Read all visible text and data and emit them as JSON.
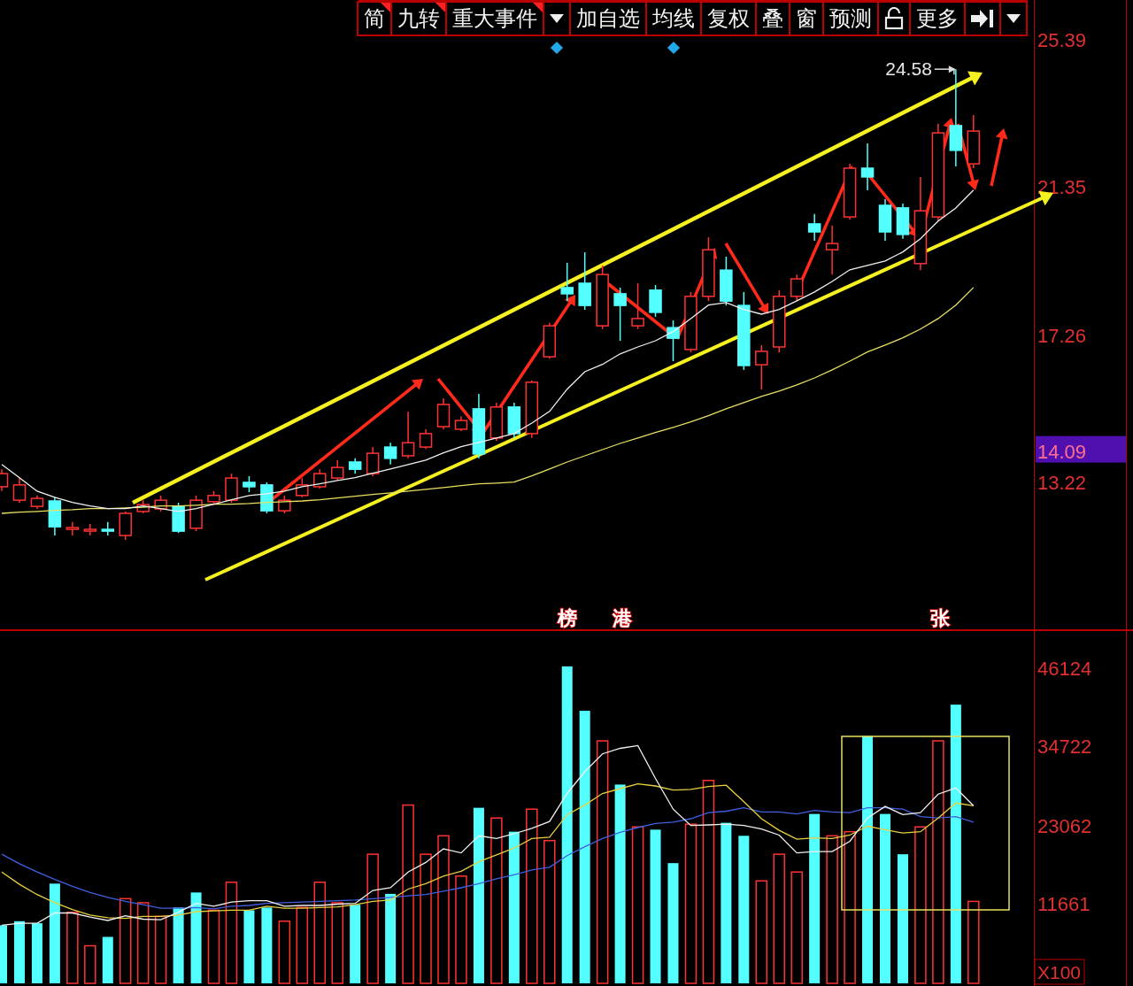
{
  "toolbar": [
    {
      "kind": "text",
      "label": "简",
      "flagged": true,
      "marked": false
    },
    {
      "kind": "text",
      "label": "九转",
      "flagged": true,
      "marked": false
    },
    {
      "kind": "text",
      "label": "重大事件",
      "flagged": true,
      "marked": false
    },
    {
      "kind": "dropdown",
      "flagged": false,
      "marked": true
    },
    {
      "kind": "text",
      "label": "加自选",
      "flagged": false,
      "marked": false
    },
    {
      "kind": "text",
      "label": "均线",
      "flagged": false,
      "marked": true
    },
    {
      "kind": "text",
      "label": "复权",
      "flagged": false,
      "marked": false
    },
    {
      "kind": "text",
      "label": "叠",
      "flagged": false,
      "marked": false
    },
    {
      "kind": "text",
      "label": "窗",
      "flagged": false,
      "marked": false
    },
    {
      "kind": "text",
      "label": "预测",
      "flagged": false,
      "marked": false
    },
    {
      "kind": "lock",
      "flagged": false,
      "marked": false
    },
    {
      "kind": "text",
      "label": "更多",
      "flagged": false,
      "marked": false
    },
    {
      "kind": "collapse",
      "flagged": false,
      "marked": false
    },
    {
      "kind": "dropdown",
      "flagged": false,
      "marked": false
    }
  ],
  "price_panel": {
    "current_price": "14.09",
    "chart_data": {
      "type": "candlestick",
      "ylim": [
        9.17,
        26.48
      ],
      "yticks": [
        {
          "value": 13.22,
          "label": "13.22"
        },
        {
          "value": 17.26,
          "label": "17.26"
        },
        {
          "value": 21.35,
          "label": "21.35"
        },
        {
          "value": 25.39,
          "label": "25.39"
        }
      ],
      "categories": [
        null,
        null,
        null,
        null,
        null,
        null,
        null,
        null,
        null,
        null,
        null,
        null,
        null,
        null,
        null,
        null,
        null,
        null,
        null,
        null,
        null,
        null,
        null,
        null,
        null,
        null,
        null,
        null,
        null,
        null,
        null,
        null,
        null,
        null,
        null,
        null,
        null,
        null,
        null,
        null,
        null,
        null,
        null,
        null,
        null,
        null,
        null,
        null,
        null,
        null,
        null,
        null,
        null,
        null,
        null,
        null
      ],
      "ohlc": [
        [
          13.11,
          13.59,
          12.99,
          13.47
        ],
        [
          12.74,
          13.35,
          12.67,
          13.16
        ],
        [
          12.57,
          12.87,
          12.5,
          12.79
        ],
        [
          12.72,
          12.82,
          11.77,
          12.01
        ],
        [
          11.94,
          12.14,
          11.77,
          11.99
        ],
        [
          11.92,
          12.09,
          11.77,
          11.94
        ],
        [
          11.94,
          12.14,
          11.77,
          11.92
        ],
        [
          11.77,
          12.43,
          11.65,
          12.38
        ],
        [
          12.43,
          12.74,
          12.38,
          12.62
        ],
        [
          12.5,
          12.87,
          12.43,
          12.74
        ],
        [
          12.57,
          12.67,
          11.84,
          11.89
        ],
        [
          11.97,
          12.87,
          11.89,
          12.74
        ],
        [
          12.7,
          12.99,
          12.62,
          12.87
        ],
        [
          12.74,
          13.47,
          12.67,
          13.35
        ],
        [
          13.23,
          13.4,
          12.96,
          13.11
        ],
        [
          13.16,
          13.23,
          12.38,
          12.45
        ],
        [
          12.45,
          12.87,
          12.38,
          12.74
        ],
        [
          12.87,
          13.35,
          12.82,
          13.16
        ],
        [
          13.11,
          13.59,
          13.06,
          13.47
        ],
        [
          13.35,
          13.84,
          13.3,
          13.64
        ],
        [
          13.79,
          13.89,
          13.47,
          13.59
        ],
        [
          13.47,
          14.2,
          13.4,
          14.03
        ],
        [
          14.2,
          14.32,
          13.72,
          13.89
        ],
        [
          13.96,
          15.17,
          13.89,
          14.32
        ],
        [
          14.2,
          14.69,
          14.15,
          14.57
        ],
        [
          14.76,
          15.54,
          14.69,
          15.37
        ],
        [
          14.69,
          15.05,
          14.64,
          14.93
        ],
        [
          15.25,
          15.66,
          13.89,
          14.01
        ],
        [
          14.45,
          15.42,
          14.37,
          15.3
        ],
        [
          15.3,
          15.42,
          14.45,
          14.57
        ],
        [
          14.57,
          16.03,
          14.45,
          15.98
        ],
        [
          16.68,
          17.61,
          16.63,
          17.53
        ],
        [
          18.58,
          19.26,
          18.21,
          18.41
        ],
        [
          18.7,
          19.55,
          17.97,
          18.09
        ],
        [
          17.53,
          19.19,
          17.44,
          18.94
        ],
        [
          18.41,
          18.58,
          17.12,
          18.09
        ],
        [
          17.53,
          18.7,
          17.44,
          17.73
        ],
        [
          18.51,
          18.65,
          17.78,
          17.9
        ],
        [
          17.48,
          17.68,
          16.56,
          17.19
        ],
        [
          16.88,
          18.46,
          16.8,
          18.34
        ],
        [
          18.34,
          19.96,
          18.21,
          19.62
        ],
        [
          19.06,
          19.43,
          18.09,
          18.21
        ],
        [
          18.09,
          18.46,
          16.32,
          16.44
        ],
        [
          16.46,
          17.0,
          15.78,
          16.83
        ],
        [
          16.95,
          18.51,
          16.8,
          18.34
        ],
        [
          18.34,
          18.94,
          18.21,
          18.82
        ],
        [
          20.33,
          20.6,
          19.87,
          20.11
        ],
        [
          19.62,
          20.28,
          18.94,
          19.79
        ],
        [
          20.52,
          21.98,
          20.45,
          21.86
        ],
        [
          21.86,
          22.54,
          21.25,
          21.62
        ],
        [
          20.84,
          21.01,
          19.87,
          20.11
        ],
        [
          20.77,
          20.89,
          19.92,
          20.04
        ],
        [
          19.24,
          21.62,
          19.06,
          20.69
        ],
        [
          20.52,
          23.08,
          20.4,
          22.83
        ],
        [
          23.03,
          24.58,
          21.91,
          22.35
        ],
        [
          21.98,
          23.32,
          21.86,
          22.88
        ]
      ],
      "series": [
        {
          "type": "line",
          "color": "#f0f0f0",
          "values": [
            13.72,
            13.36,
            12.99,
            12.82,
            12.68,
            12.58,
            12.51,
            12.51,
            12.58,
            12.51,
            12.43,
            12.51,
            12.63,
            12.75,
            12.87,
            12.92,
            12.99,
            13.11,
            13.19,
            13.28,
            13.36,
            13.48,
            13.6,
            13.72,
            13.84,
            14.04,
            14.21,
            14.33,
            14.45,
            14.57,
            14.86,
            15.18,
            15.79,
            16.27,
            16.47,
            16.76,
            16.95,
            17.12,
            17.37,
            17.73,
            18.1,
            18.17,
            17.98,
            17.85,
            17.98,
            18.22,
            18.46,
            18.75,
            19.07,
            19.19,
            19.31,
            19.56,
            19.92,
            20.41,
            20.77,
            21.26
          ]
        },
        {
          "type": "line",
          "color": "#e8e060",
          "values": [
            12.38,
            12.41,
            12.43,
            12.46,
            12.48,
            12.51,
            12.51,
            12.53,
            12.55,
            12.58,
            12.58,
            12.6,
            12.63,
            12.63,
            12.65,
            12.68,
            12.7,
            12.72,
            12.75,
            12.8,
            12.85,
            12.9,
            12.94,
            12.99,
            13.04,
            13.09,
            13.14,
            13.19,
            13.21,
            13.24,
            13.41,
            13.6,
            13.79,
            13.96,
            14.13,
            14.3,
            14.45,
            14.6,
            14.74,
            14.89,
            15.06,
            15.25,
            15.42,
            15.59,
            15.74,
            15.91,
            16.1,
            16.32,
            16.56,
            16.81,
            17.0,
            17.2,
            17.44,
            17.73,
            18.1,
            18.58
          ]
        }
      ]
    },
    "high_label": "24.58",
    "event_markers": [
      {
        "label": "榜"
      },
      {
        "label": "港"
      },
      {
        "label": "张"
      }
    ]
  },
  "volume_panel": {
    "unit": "X100",
    "chart_data": {
      "type": "bar",
      "stacked": true,
      "ylim": [
        0,
        51700
      ],
      "yticks": [
        {
          "value": 11661,
          "label": "11661"
        },
        {
          "value": 23062,
          "label": "23062"
        },
        {
          "value": 34722,
          "label": "34722"
        },
        {
          "value": 46124,
          "label": "46124"
        }
      ],
      "categories": [
        null,
        null,
        null,
        null,
        null,
        null,
        null,
        null,
        null,
        null,
        null,
        null,
        null,
        null,
        null,
        null,
        null,
        null,
        null,
        null,
        null,
        null,
        null,
        null,
        null,
        null,
        null,
        null,
        null,
        null,
        null,
        null,
        null,
        null,
        null,
        null,
        null,
        null,
        null,
        null,
        null,
        null,
        null,
        null,
        null,
        null,
        null,
        null,
        null,
        null,
        null,
        null,
        null,
        null,
        null,
        null
      ],
      "series": [
        {
          "type": "bar",
          "color": "#ff3232",
          "values": [
            null,
            null,
            null,
            null,
            10400,
            5500,
            null,
            12400,
            11800,
            9800,
            null,
            null,
            10700,
            14800,
            null,
            null,
            9100,
            11100,
            14800,
            11800,
            null,
            18900,
            null,
            26100,
            18900,
            21600,
            15700,
            null,
            24200,
            null,
            25500,
            20900,
            null,
            null,
            35500,
            null,
            22900,
            null,
            null,
            23300,
            29700,
            null,
            null,
            15000,
            18900,
            16300,
            null,
            21600,
            22200,
            null,
            null,
            null,
            22900,
            35500,
            null,
            12000
          ]
        },
        {
          "type": "bar",
          "color": "#54ffff",
          "values": [
            8500,
            9100,
            8800,
            14600,
            null,
            null,
            6800,
            null,
            null,
            null,
            11100,
            13300,
            null,
            null,
            10700,
            11100,
            null,
            null,
            null,
            null,
            11500,
            null,
            13100,
            null,
            null,
            null,
            null,
            25700,
            null,
            22200,
            null,
            null,
            46400,
            39900,
            null,
            29100,
            null,
            22500,
            17600,
            null,
            null,
            23500,
            21600,
            null,
            null,
            null,
            24800,
            null,
            null,
            36200,
            24800,
            18900,
            null,
            null,
            40800,
            null
          ]
        },
        {
          "type": "line",
          "color": "#4060e0",
          "values": [
            18900,
            17500,
            16300,
            15200,
            14200,
            13300,
            12600,
            12000,
            11500,
            11000,
            11000,
            11100,
            10900,
            11300,
            11400,
            11700,
            11800,
            11900,
            12000,
            12100,
            12200,
            12400,
            12600,
            12800,
            13000,
            13500,
            14000,
            14600,
            15300,
            15900,
            16600,
            17000,
            18700,
            20000,
            21200,
            22100,
            22800,
            23400,
            23600,
            24100,
            25000,
            25200,
            25700,
            25100,
            25100,
            24800,
            25300,
            25100,
            25000,
            25700,
            25700,
            25500,
            24400,
            24200,
            24400,
            23600
          ]
        },
        {
          "type": "line",
          "color": "#e8d040",
          "values": [
            16300,
            14500,
            13000,
            11800,
            10800,
            10000,
            9600,
            9500,
            9800,
            9800,
            10000,
            10500,
            10600,
            10700,
            10700,
            11300,
            11000,
            11000,
            11100,
            11200,
            11500,
            12000,
            12200,
            13800,
            14600,
            15700,
            16400,
            17800,
            18800,
            19800,
            21200,
            21400,
            24700,
            26100,
            27800,
            28500,
            29200,
            28900,
            28300,
            28400,
            28800,
            29000,
            26600,
            24100,
            22400,
            21100,
            21300,
            21200,
            21700,
            23000,
            22500,
            22000,
            22200,
            24200,
            26400,
            26000
          ]
        },
        {
          "type": "line",
          "color": "#f0f0f0",
          "values": [
            8500,
            8800,
            8800,
            10300,
            10300,
            9700,
            9200,
            9900,
            9400,
            9300,
            10400,
            11700,
            11300,
            11900,
            12100,
            12100,
            11300,
            11400,
            11400,
            11600,
            11700,
            13600,
            14000,
            16300,
            17700,
            19700,
            19100,
            21600,
            21200,
            21900,
            22700,
            23700,
            27800,
            31000,
            33600,
            34400,
            34800,
            30000,
            25500,
            23100,
            23200,
            23300,
            23100,
            22600,
            21700,
            19100,
            19300,
            19300,
            20800,
            24200,
            25900,
            24700,
            25000,
            27700,
            28600,
            26000
          ]
        }
      ]
    }
  }
}
